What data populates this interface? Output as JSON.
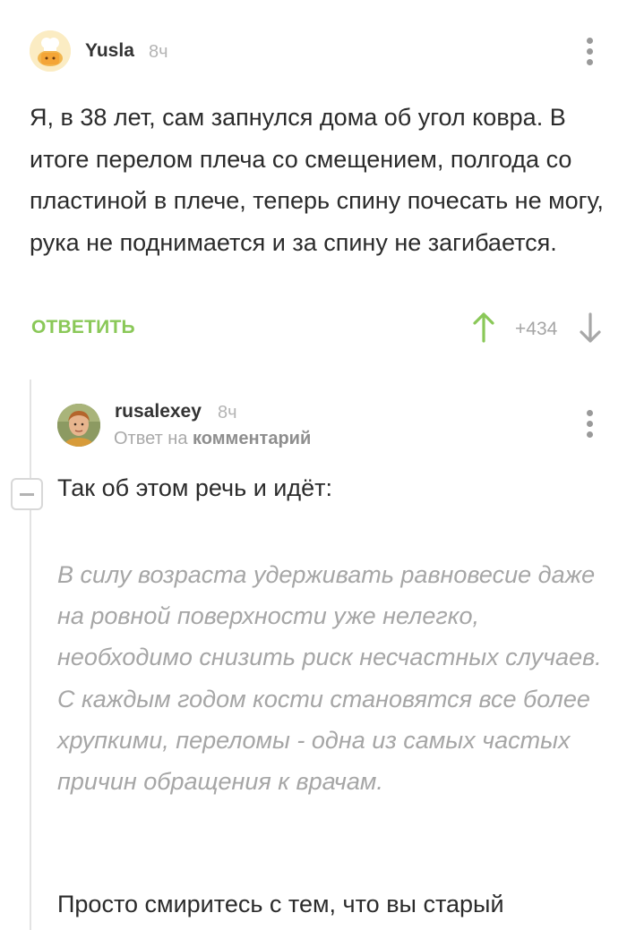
{
  "comment": {
    "author": "Yusla",
    "time": "8ч",
    "text": "Я, в 38 лет, сам запнулся дома об угол ковра.  В итоге перелом плеча со смещением, полгода со пластиной в плече, теперь спину почесать не могу, рука не поднимается и за спину не загибается.",
    "reply_label": "ОТВЕТИТЬ",
    "score": "+434",
    "accent_color": "#8ac858"
  },
  "reply": {
    "author": "rusalexey",
    "time": "8ч",
    "reply_prefix": "Ответ на",
    "reply_target": "комментарий",
    "text1": "Так об этом речь и идёт:",
    "quote": "В силу возраста удерживать равновесие даже на ровной поверхности уже нелегко, необходимо снизить риск несчастных случаев. С каждым годом кости становятся все более хрупкими, переломы - одна из самых частых причин обращения к врачам.",
    "text2": "Просто смиритесь с тем, что вы старый"
  },
  "icons": [
    "chef-avatar-icon",
    "more-vertical-icon",
    "upvote-arrow-icon",
    "downvote-arrow-icon",
    "collapse-minus-icon"
  ]
}
